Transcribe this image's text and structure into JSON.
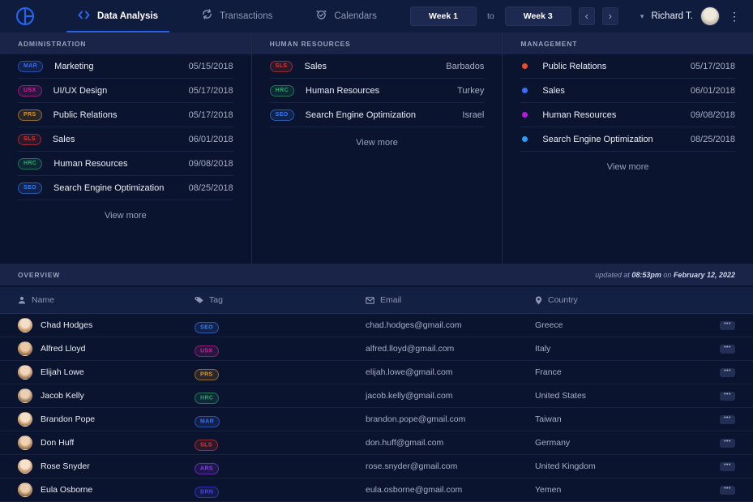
{
  "nav": {
    "tabs": [
      {
        "label": "Data Analysis"
      },
      {
        "label": "Transactions"
      },
      {
        "label": "Calendars"
      }
    ],
    "week_range": {
      "from": "Week 1",
      "to_label": "to",
      "to": "Week 3"
    },
    "user": {
      "name": "Richard T."
    }
  },
  "icons": {
    "chevron_left": "‹",
    "chevron_right": "›",
    "caret_down": "▾",
    "kebab": "⋮",
    "ellipsis": "•••"
  },
  "colors": {
    "accent_blue": "#2563eb",
    "nav_bg": "#0f1c3e",
    "band_bg": "#192448",
    "page_bg": "#0b142f"
  },
  "sections": {
    "administration": {
      "title": "ADMINISTRATION",
      "view_more": "View more",
      "rows": [
        {
          "tag": "MAR",
          "tag_color": "#3b6ff0",
          "label": "Marketing",
          "value": "05/15/2018"
        },
        {
          "tag": "USX",
          "tag_color": "#d6219c",
          "label": "UI/UX Design",
          "value": "05/17/2018"
        },
        {
          "tag": "PRS",
          "tag_color": "#dd9a2b",
          "label": "Public Relations",
          "value": "05/17/2018"
        },
        {
          "tag": "SLS",
          "tag_color": "#e03a34",
          "label": "Sales",
          "value": "06/01/2018"
        },
        {
          "tag": "HRC",
          "tag_color": "#2aa56a",
          "label": "Human Resources",
          "value": "09/08/2018"
        },
        {
          "tag": "SEO",
          "tag_color": "#3a7df0",
          "label": "Search Engine Optimization",
          "value": "08/25/2018"
        }
      ]
    },
    "human_resources": {
      "title": "HUMAN RESOURCES",
      "view_more": "View more",
      "rows": [
        {
          "tag": "SLS",
          "tag_color": "#e03a34",
          "label": "Sales",
          "value": "Barbados"
        },
        {
          "tag": "HRC",
          "tag_color": "#2aa56a",
          "label": "Human Resources",
          "value": "Turkey"
        },
        {
          "tag": "SEO",
          "tag_color": "#3a7df0",
          "label": "Search Engine Optimization",
          "value": "Israel"
        }
      ]
    },
    "management": {
      "title": "MANAGEMENT",
      "view_more": "View more",
      "rows": [
        {
          "dot_color": "#e84e2c",
          "label": "Public Relations",
          "value": "05/17/2018"
        },
        {
          "dot_color": "#3b6ff0",
          "label": "Sales",
          "value": "06/01/2018"
        },
        {
          "dot_color": "#b01fd6",
          "label": "Human Resources",
          "value": "09/08/2018"
        },
        {
          "dot_color": "#2e9bf6",
          "label": "Search Engine Optimization",
          "value": "08/25/2018"
        }
      ]
    }
  },
  "overview": {
    "title": "OVERVIEW",
    "updated_prefix": "updated at",
    "updated_time": "08:53pm",
    "updated_connector": "on",
    "updated_date": "February 12, 2022"
  },
  "table": {
    "headers": [
      {
        "label": "Name"
      },
      {
        "label": "Tag"
      },
      {
        "label": "Email"
      },
      {
        "label": "Country"
      }
    ],
    "rows": [
      {
        "name": "Chad Hodges",
        "tag": "SEO",
        "tag_color": "#3a7df0",
        "email": "chad.hodges@gmail.com",
        "country": "Greece"
      },
      {
        "name": "Alfred Lloyd",
        "tag": "USX",
        "tag_color": "#d6219c",
        "email": "alfred.lloyd@gmail.com",
        "country": "Italy"
      },
      {
        "name": "Elijah Lowe",
        "tag": "PRS",
        "tag_color": "#dd9a2b",
        "email": "elijah.lowe@gmail.com",
        "country": "France"
      },
      {
        "name": "Jacob Kelly",
        "tag": "HRC",
        "tag_color": "#2aa56a",
        "email": "jacob.kelly@gmail.com",
        "country": "United States"
      },
      {
        "name": "Brandon Pope",
        "tag": "MAR",
        "tag_color": "#3b6ff0",
        "email": "brandon.pope@gmail.com",
        "country": "Taiwan"
      },
      {
        "name": "Don Huff",
        "tag": "SLS",
        "tag_color": "#e03a34",
        "email": "don.huff@gmail.com",
        "country": "Germany"
      },
      {
        "name": "Rose Snyder",
        "tag": "ARS",
        "tag_color": "#8a3bef",
        "email": "rose.snyder@gmail.com",
        "country": "United Kingdom"
      },
      {
        "name": "Eula Osborne",
        "tag": "BRN",
        "tag_color": "#4840e8",
        "email": "eula.osborne@gmail.com",
        "country": "Yemen"
      }
    ]
  }
}
